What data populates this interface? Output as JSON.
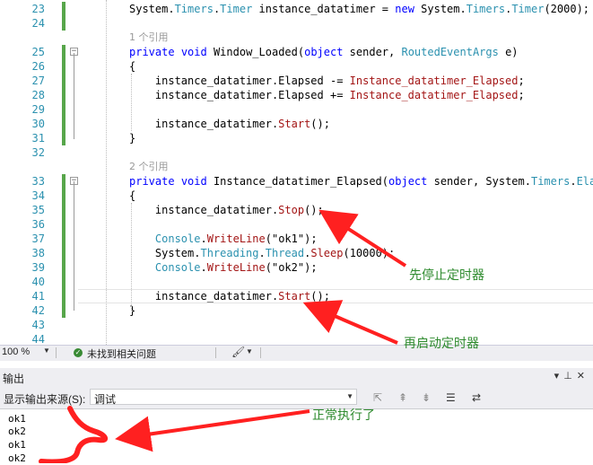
{
  "editor": {
    "lines": [
      {
        "n": "23",
        "segs": [
          [
            "",
            "System."
          ],
          [
            "ty",
            "Timers"
          ],
          [
            "",
            "."
          ],
          [
            "ty",
            "Timer"
          ],
          [
            "",
            " instance_datatimer = "
          ],
          [
            "kw",
            "new"
          ],
          [
            "",
            " System."
          ],
          [
            "ty",
            "Timers"
          ],
          [
            "",
            "."
          ],
          [
            "ty",
            "Timer"
          ],
          [
            "",
            "(2000);"
          ]
        ]
      },
      {
        "n": "24",
        "segs": []
      },
      {
        "n": "25",
        "segs": [
          [
            "kw",
            "private"
          ],
          [
            "",
            " "
          ],
          [
            "kw",
            "void"
          ],
          [
            "",
            " Window_Loaded("
          ],
          [
            "kw",
            "object"
          ],
          [
            "",
            " sender, "
          ],
          [
            "ty",
            "RoutedEventArgs"
          ],
          [
            "",
            " e)"
          ]
        ]
      },
      {
        "n": "26",
        "segs": [
          [
            "",
            "{"
          ]
        ]
      },
      {
        "n": "27",
        "segs": [
          [
            "",
            "    instance_datatimer.Elapsed -= "
          ],
          [
            "str",
            "Instance_datatimer_Elapsed"
          ],
          [
            "",
            ";"
          ]
        ]
      },
      {
        "n": "28",
        "segs": [
          [
            "",
            "    instance_datatimer.Elapsed += "
          ],
          [
            "str",
            "Instance_datatimer_Elapsed"
          ],
          [
            "",
            ";"
          ]
        ]
      },
      {
        "n": "29",
        "segs": []
      },
      {
        "n": "30",
        "segs": [
          [
            "",
            "    instance_datatimer."
          ],
          [
            "str",
            "Start"
          ],
          [
            "",
            "();"
          ]
        ]
      },
      {
        "n": "31",
        "segs": [
          [
            "",
            "}"
          ]
        ]
      },
      {
        "n": "32",
        "segs": []
      },
      {
        "n": "33",
        "segs": [
          [
            "kw",
            "private"
          ],
          [
            "",
            " "
          ],
          [
            "kw",
            "void"
          ],
          [
            "",
            " Instance_datatimer_Elapsed("
          ],
          [
            "kw",
            "object"
          ],
          [
            "",
            " sender, System."
          ],
          [
            "ty",
            "Timers"
          ],
          [
            "",
            "."
          ],
          [
            "ty",
            "Elaps"
          ]
        ]
      },
      {
        "n": "34",
        "segs": [
          [
            "",
            "{"
          ]
        ]
      },
      {
        "n": "35",
        "segs": [
          [
            "",
            "    instance_datatimer."
          ],
          [
            "str",
            "Stop"
          ],
          [
            "",
            "();"
          ]
        ]
      },
      {
        "n": "36",
        "segs": []
      },
      {
        "n": "37",
        "segs": [
          [
            "",
            "    "
          ],
          [
            "ty",
            "Console"
          ],
          [
            "",
            "."
          ],
          [
            "str",
            "WriteLine"
          ],
          [
            "",
            "(\"ok1\");"
          ]
        ]
      },
      {
        "n": "38",
        "segs": [
          [
            "",
            "    System."
          ],
          [
            "ty",
            "Threading"
          ],
          [
            "",
            "."
          ],
          [
            "ty",
            "Thread"
          ],
          [
            "",
            "."
          ],
          [
            "str",
            "Sleep"
          ],
          [
            "",
            "(10000);"
          ]
        ]
      },
      {
        "n": "39",
        "segs": [
          [
            "",
            "    "
          ],
          [
            "ty",
            "Console"
          ],
          [
            "",
            "."
          ],
          [
            "str",
            "WriteLine"
          ],
          [
            "",
            "(\"ok2\");"
          ]
        ]
      },
      {
        "n": "40",
        "segs": []
      },
      {
        "n": "41",
        "segs": [
          [
            "",
            "    instance_datatimer."
          ],
          [
            "str",
            "Start"
          ],
          [
            "",
            "();"
          ]
        ]
      },
      {
        "n": "42",
        "segs": [
          [
            "",
            "}"
          ]
        ]
      },
      {
        "n": "43",
        "segs": []
      },
      {
        "n": "44",
        "segs": []
      }
    ],
    "codelens1": "1 个引用",
    "codelens2": "2 个引用"
  },
  "statusbar": {
    "zoom": "100 %",
    "issues": "未找到相关问题"
  },
  "output": {
    "title": "输出",
    "source_label": "显示输出来源(S):",
    "source_value": "调试",
    "lines": [
      "ok1",
      "ok2",
      "ok1",
      "ok2"
    ]
  },
  "annotations": {
    "stop_note": "先停止定时器",
    "restart_note": "再启动定时器",
    "normal_note": "正常执行了"
  },
  "colors": {
    "arrow": "#ff2020",
    "note": "#2d8a2d",
    "change_bar": "#57a64a"
  }
}
